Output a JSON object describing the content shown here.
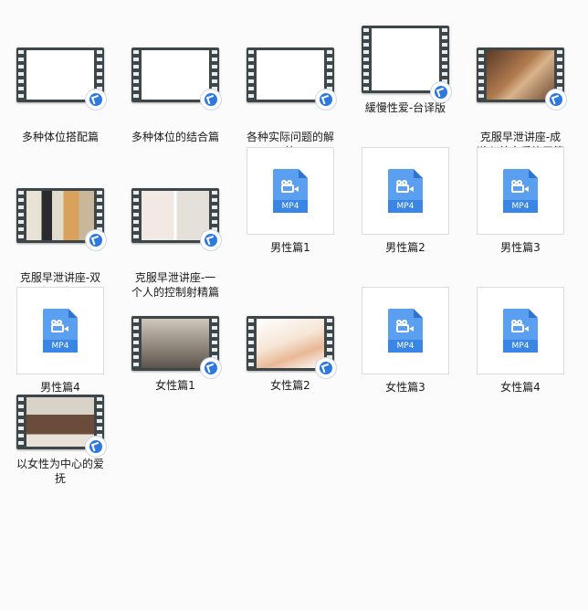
{
  "files": [
    {
      "label": "多种体位搭配篇",
      "type": "video-shortcut",
      "thumb": "blank"
    },
    {
      "label": "多种体位的结合篇",
      "type": "video-shortcut",
      "thumb": "blank"
    },
    {
      "label": "各种实际问题的解答",
      "type": "video-shortcut",
      "thumb": "blank"
    },
    {
      "label": "緩慢性爱-台译版",
      "type": "video-shortcut",
      "thumb": "blank-tall"
    },
    {
      "label": "克服早泄讲座-成濑心美实质练习篇",
      "type": "video-shortcut",
      "thumb": "photo1"
    },
    {
      "label": "克服早泄讲座-双人实质练习篇",
      "type": "video-shortcut",
      "thumb": "photo2"
    },
    {
      "label": "克服早泄讲座-一个人的控制射精篇",
      "type": "video-shortcut",
      "thumb": "photo3"
    },
    {
      "label": "男性篇1",
      "type": "mp4",
      "ext": "MP4"
    },
    {
      "label": "男性篇2",
      "type": "mp4",
      "ext": "MP4"
    },
    {
      "label": "男性篇3",
      "type": "mp4",
      "ext": "MP4"
    },
    {
      "label": "男性篇4",
      "type": "mp4",
      "ext": "MP4"
    },
    {
      "label": "女性篇1",
      "type": "video-shortcut",
      "thumb": "photo4"
    },
    {
      "label": "女性篇2",
      "type": "video-shortcut",
      "thumb": "photo5"
    },
    {
      "label": "女性篇3",
      "type": "mp4",
      "ext": "MP4"
    },
    {
      "label": "女性篇4",
      "type": "mp4",
      "ext": "MP4"
    },
    {
      "label": "以女性为中心的爱抚",
      "type": "video-shortcut",
      "thumb": "photo6"
    }
  ],
  "colors": {
    "accent": "#3a86e6",
    "background": "#fbfbfb"
  }
}
